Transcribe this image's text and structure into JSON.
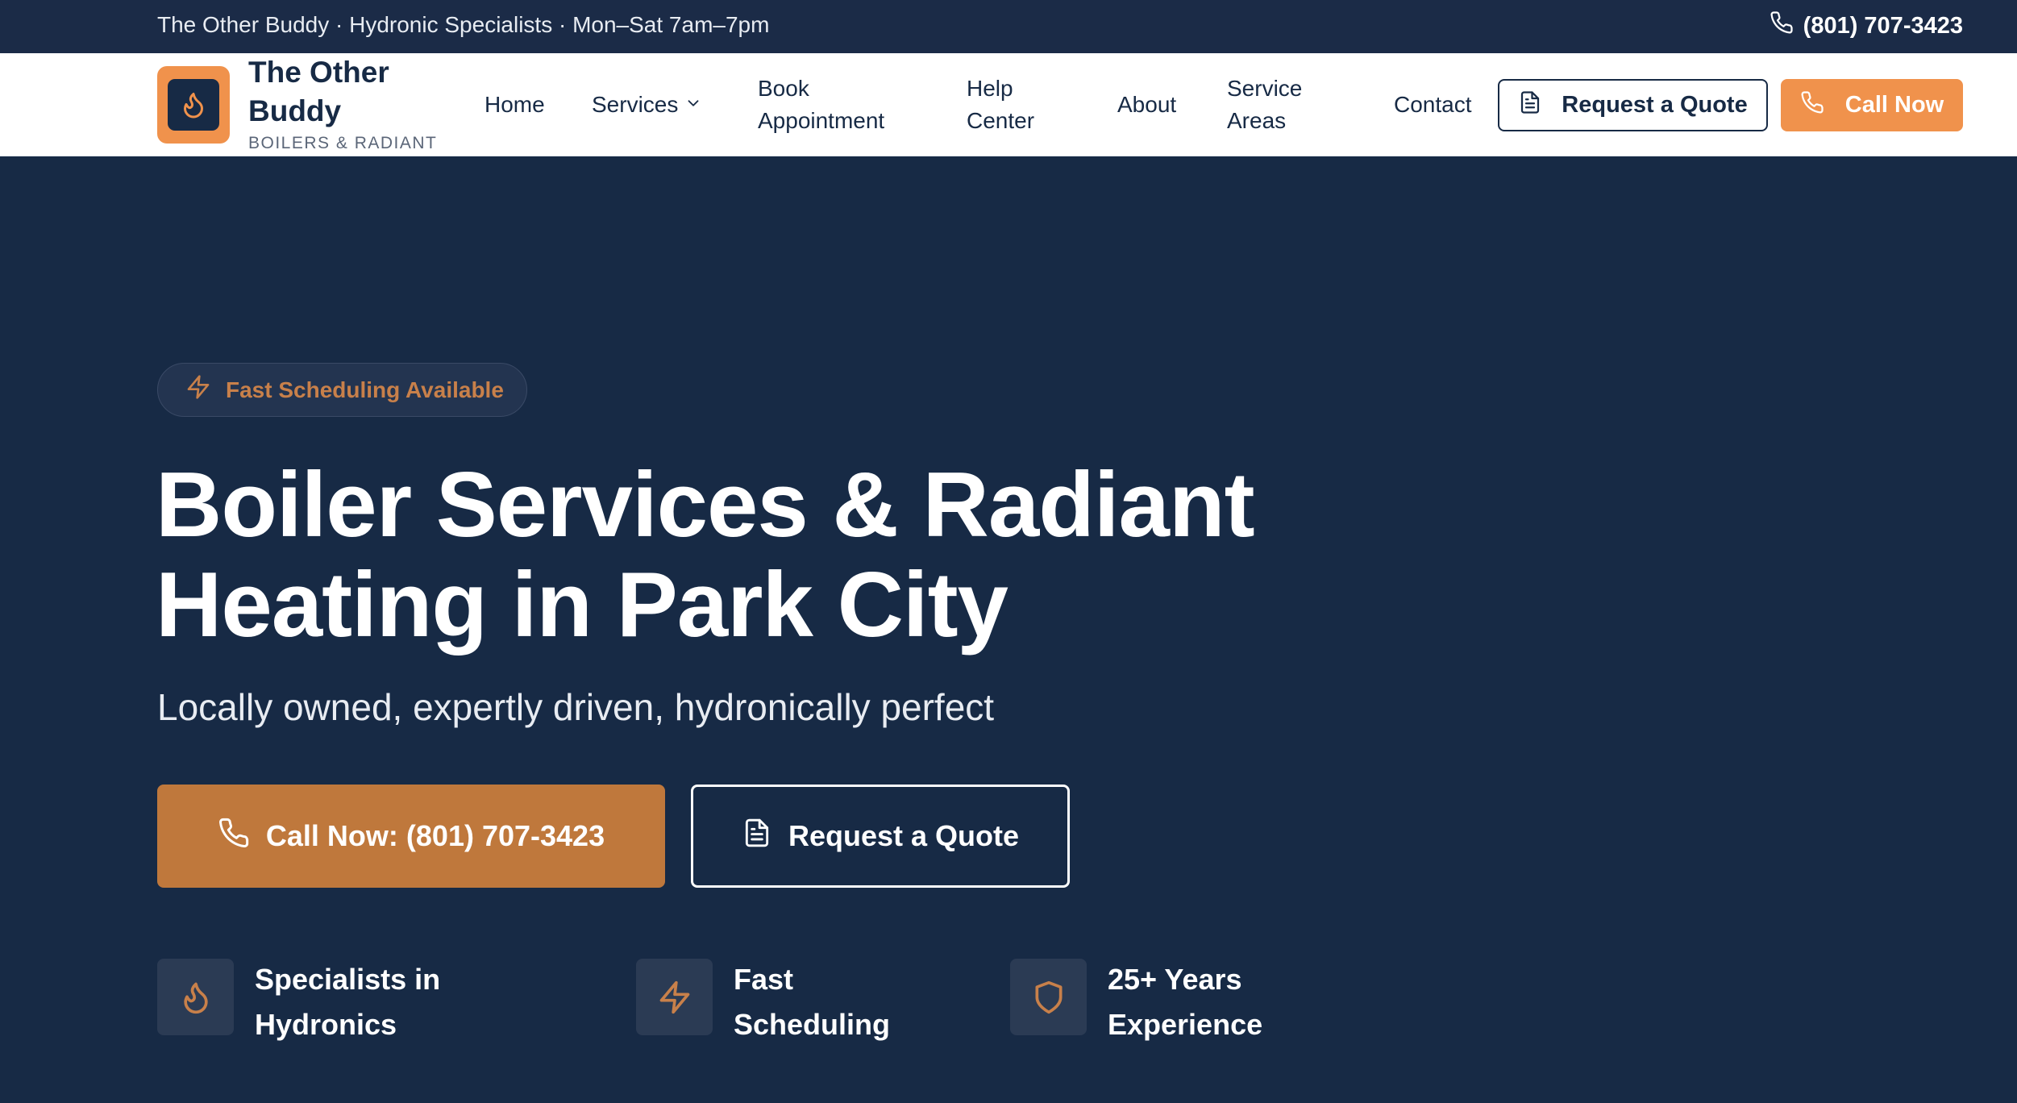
{
  "topbar": {
    "info": "The Other Buddy · Hydronic Specialists · Mon–Sat 7am–7pm",
    "phone": "(801) 707-3423"
  },
  "brand": {
    "name": "The Other Buddy",
    "tagline": "BOILERS & RADIANT",
    "icon": "flame-icon"
  },
  "nav": {
    "items": [
      {
        "label": "Home"
      },
      {
        "label": "Services",
        "icon": "chevron-down-icon"
      },
      {
        "label": "Book Appointment"
      },
      {
        "label": "Help Center"
      },
      {
        "label": "About"
      },
      {
        "label": "Service Areas"
      },
      {
        "label": "Contact"
      }
    ],
    "quote_button": "Request a Quote",
    "call_button": "Call Now"
  },
  "hero": {
    "badge": "Fast Scheduling Available",
    "title": "Boiler Services & Radiant Heating in Park City",
    "subtitle": "Locally owned, expertly driven, hydronically perfect",
    "cta_call": "Call Now: (801) 707-3423",
    "cta_quote": "Request a Quote"
  },
  "features": [
    {
      "icon": "flame-icon",
      "label": "Specialists in Hydronics"
    },
    {
      "icon": "lightning-icon",
      "label": "Fast Scheduling"
    },
    {
      "icon": "shield-icon",
      "label": "25+ Years Experience"
    }
  ],
  "colors": {
    "navy": "#172a45",
    "orange": "#f0924c",
    "orange_dark": "#bf783c",
    "accent_text": "#c8804a"
  }
}
